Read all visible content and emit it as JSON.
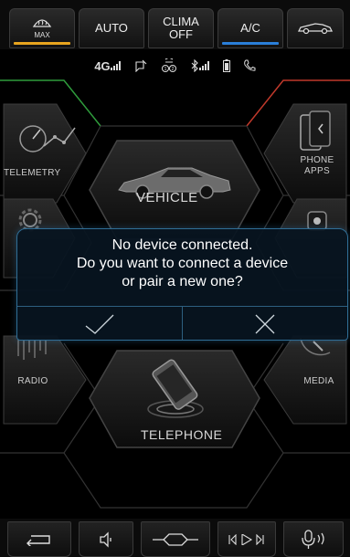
{
  "climate": {
    "max_label": "MAX",
    "auto_label": "AUTO",
    "clima_line1": "CLIMA",
    "clima_line2": "OFF",
    "ac_label": "A/C",
    "colors": {
      "max_bar": "#e8a51f",
      "ac_bar": "#2a7fd9"
    }
  },
  "status": {
    "network": "4G"
  },
  "home": {
    "telemetry_label": "TELEMETRY",
    "phone_apps_line1": "PHONE",
    "phone_apps_line2": "APPS",
    "vehicle_label": "VEHICLE",
    "radio_label": "RADIO",
    "media_label": "MEDIA",
    "telephone_label": "TELEPHONE",
    "colors": {
      "accent_green": "#2f9c3c",
      "accent_red": "#c0392b"
    }
  },
  "dialog": {
    "line1": "No device connected.",
    "line2": "Do you want to connect a device",
    "line3": "or pair a new one?",
    "border_color": "#2f6e96"
  },
  "bottom": {
    "icons": [
      "back-icon",
      "volume-icon",
      "home-icon",
      "media-controls-icon",
      "voice-icon"
    ]
  }
}
